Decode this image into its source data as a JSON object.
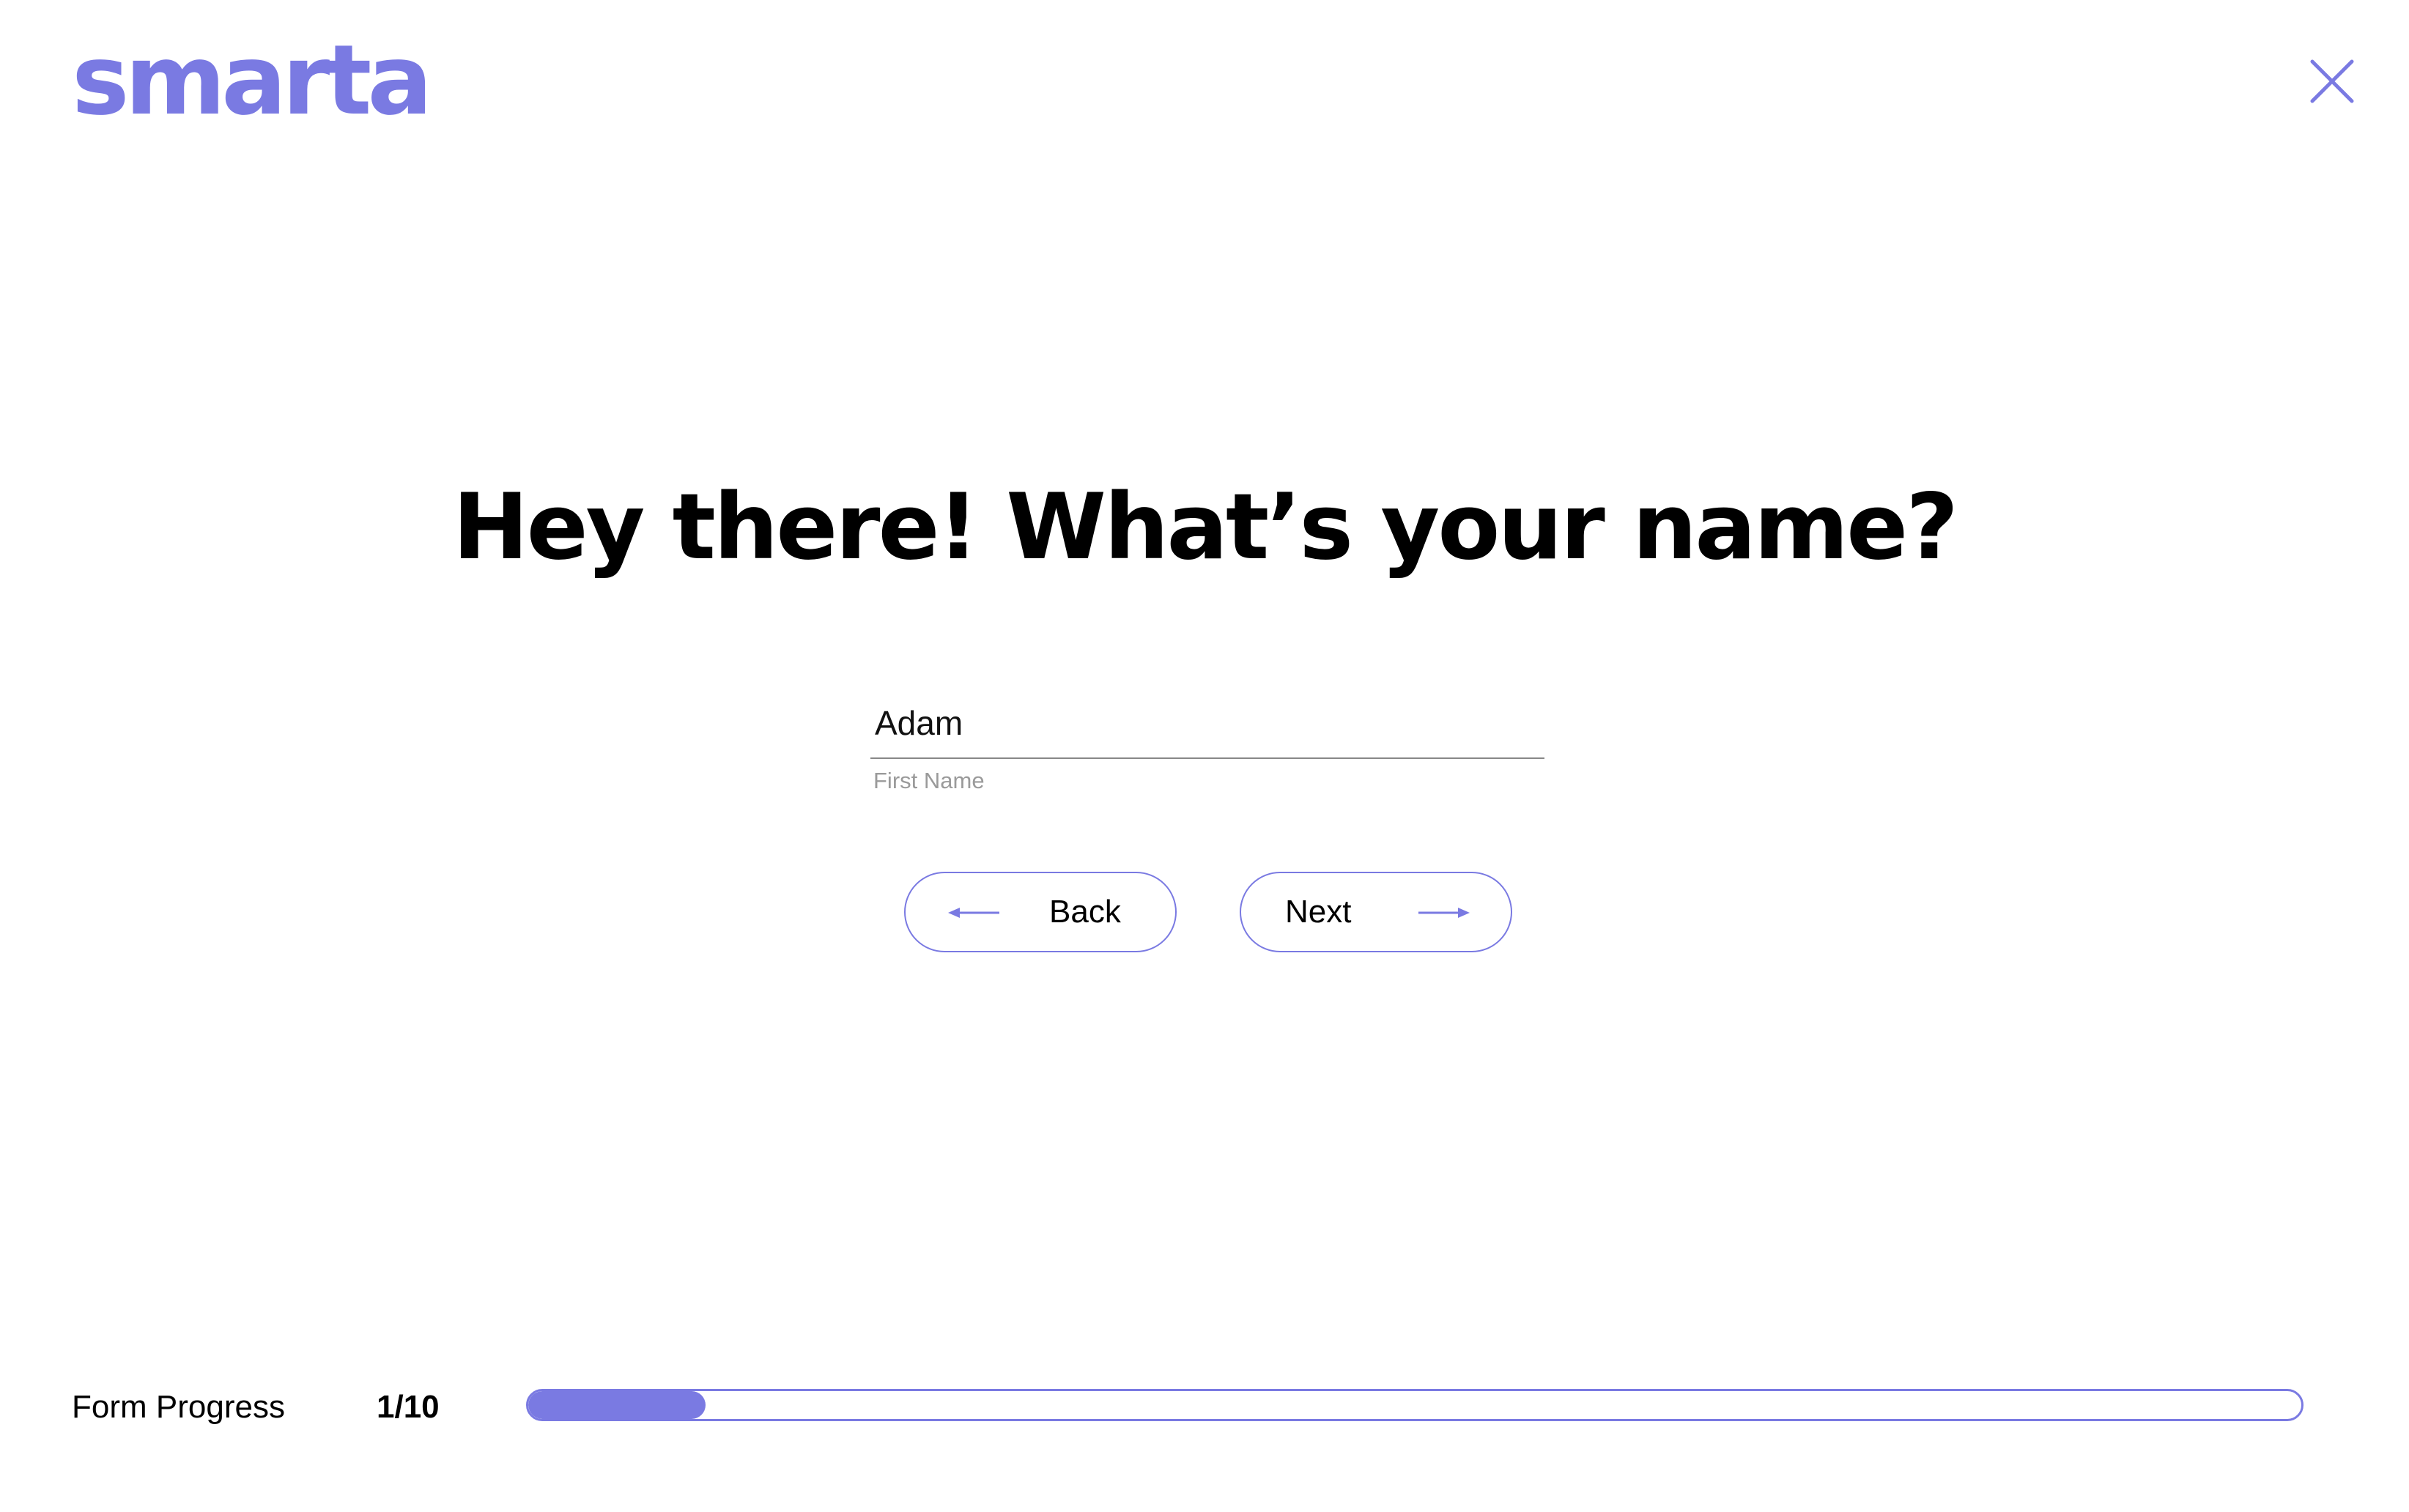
{
  "brand": {
    "logo_text": "smarta",
    "accent_color": "#7a7ae2"
  },
  "header": {
    "close_icon": "close-icon"
  },
  "main": {
    "heading": "Hey there! What’s your name?",
    "first_name": {
      "value": "Adam",
      "label": "First Name"
    },
    "back_button": {
      "label": "Back",
      "icon": "arrow-left-icon"
    },
    "next_button": {
      "label": "Next",
      "icon": "arrow-right-icon"
    }
  },
  "footer": {
    "progress_label": "Form Progress",
    "progress_count": "1/10",
    "progress_fraction": 0.1
  }
}
